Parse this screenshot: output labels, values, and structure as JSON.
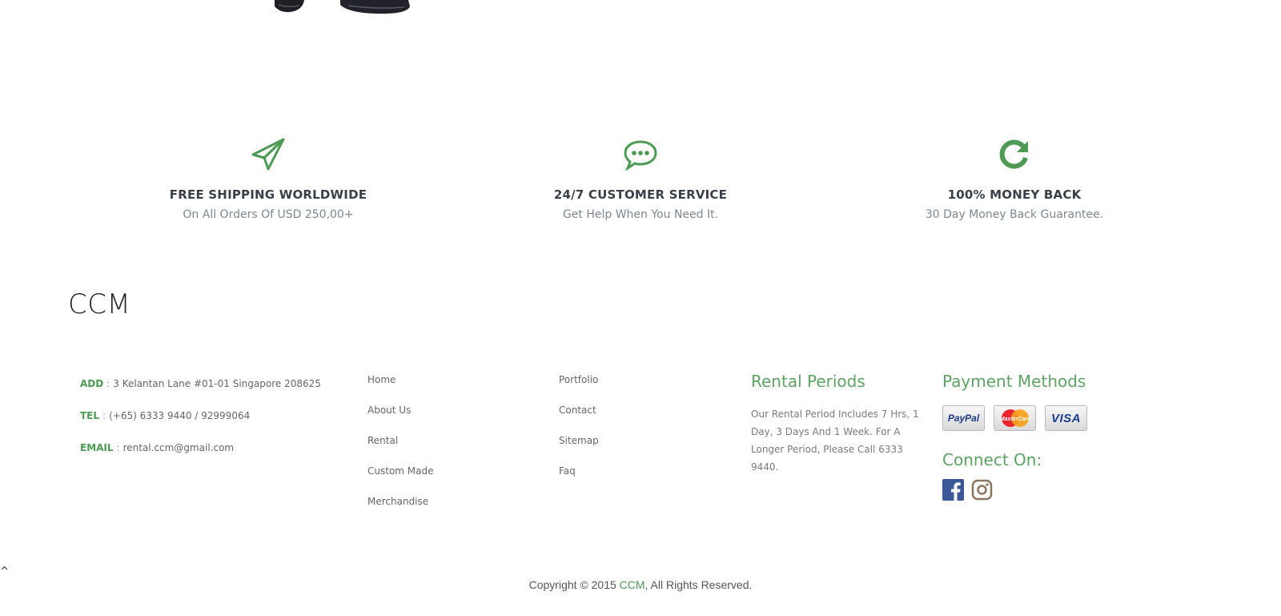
{
  "colors": {
    "accent": "#4e9a55",
    "heading": "#5fa266",
    "muted": "#7d8791"
  },
  "features": [
    {
      "icon": "paper-plane-icon",
      "title": "FREE SHIPPING WORLDWIDE",
      "subtitle": "On All Orders Of USD 250,00+"
    },
    {
      "icon": "chat-bubble-icon",
      "title": "24/7 CUSTOMER SERVICE",
      "subtitle": "Get Help When You Need It."
    },
    {
      "icon": "refresh-icon",
      "title": "100% MONEY BACK",
      "subtitle": "30 Day Money Back Guarantee."
    }
  ],
  "footer": {
    "brand": "CCM",
    "contact": {
      "address_label": "ADD",
      "address": "3 Kelantan Lane #01-01 Singapore 208625",
      "tel_label": "TEL",
      "tel": "(+65) 6333 9440 / 92999064",
      "email_label": "EMAIL",
      "email": "rental.ccm@gmail.com",
      "separator": ":"
    },
    "links_col1": [
      "Home",
      "About Us",
      "Rental",
      "Custom Made",
      "Merchandise"
    ],
    "links_col2": [
      "Portfolio",
      "Contact",
      "Sitemap",
      "Faq"
    ],
    "rental": {
      "title": "Rental Periods",
      "text": "Our Rental Period Includes 7 Hrs, 1 Day, 3 Days And 1 Week. For A Longer Period, Please Call 6333 9440."
    },
    "payment": {
      "title": "Payment Methods",
      "cards": [
        "PayPal",
        "MasterCard",
        "VISA"
      ]
    },
    "connect": {
      "title": "Connect On:",
      "icons": [
        "facebook-icon",
        "instagram-icon"
      ]
    }
  },
  "back_to_top": "^",
  "copyright": {
    "prefix": "Copyright © 2015",
    "brand": "CCM",
    "suffix": ", All Rights Reserved."
  }
}
